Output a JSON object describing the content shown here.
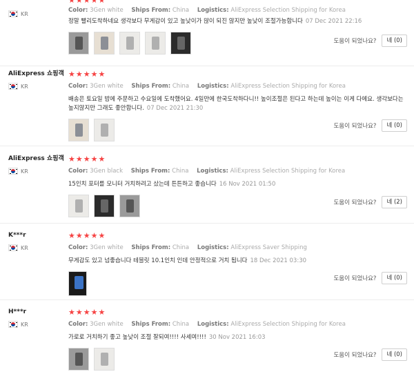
{
  "labels": {
    "color": "Color:",
    "ships_from": "Ships From:",
    "logistics": "Logistics:",
    "helpful": "도움이 되었나요?"
  },
  "reviews": [
    {
      "user": "",
      "country": "KR",
      "stars": 5,
      "color": "3Gen white",
      "ships_from": "China",
      "logistics": "AliExpress Selection Shipping for Korea",
      "text": "정말 빨리도착하네요 생각보다 무게감이 있고 높낮이가 많이 되진 않지만 높낮이 조절가능합니다",
      "date": "07 Dec 2021 22:16",
      "photos": [
        "grey-stand-photo",
        "tan-stand-photo",
        "stand-photo",
        "stand-photo",
        "dark-stand-photo"
      ],
      "helpful_button": "네 (0)"
    },
    {
      "user": "AliExpress 쇼핑객",
      "country": "KR",
      "stars": 5,
      "color": "3Gen white",
      "ships_from": "China",
      "logistics": "AliExpress Selection Shipping for Korea",
      "text": "배송은 토요일 밤에 주문하고 수요일에 도착했어요. 4일만에 한국도착하다니!! 높이조절은 된다고 하는데 높이는 이게 다에요. 생각보다는 높지않지만 그래도 좋안합니다.",
      "date": "07 Dec 2021 21:30",
      "photos": [
        "tan-stand-photo",
        "stand-photo"
      ],
      "helpful_button": "네 (0)"
    },
    {
      "user": "AliExpress 쇼핑객",
      "country": "KR",
      "stars": 5,
      "color": "3Gen black",
      "ships_from": "China",
      "logistics": "AliExpress Selection Shipping for Korea",
      "text": "15인치 포터를 모니터 거치하려고 샀는데 튼튼하고 좋습니다",
      "date": "16 Nov 2021 01:50",
      "photos": [
        "stand-photo",
        "dark-stand-photo",
        "grey-stand-photo"
      ],
      "helpful_button": "네 (2)"
    },
    {
      "user": "K***r",
      "country": "KR",
      "stars": 5,
      "color": "3Gen white",
      "ships_from": "China",
      "logistics": "AliExpress Saver Shipping",
      "text": "무게감도 있고 넘좋습니다 테블릿 10.1인치 인데 안정적으로 거치 됩니다",
      "date": "18 Dec 2021 03:30",
      "photos": [
        "tablet-on-stand-photo"
      ],
      "helpful_button": "네 (0)"
    },
    {
      "user": "H***r",
      "country": "KR",
      "stars": 5,
      "color": "3Gen white",
      "ships_from": "China",
      "logistics": "AliExpress Selection Shipping for Korea",
      "text": "가로로 거치하기 좋고 높낮이 조절 잘되여!!!! 사세여!!!!",
      "date": "30 Nov 2021 16:03",
      "photos": [
        "grey-stand-photo",
        "stand-photo"
      ],
      "helpful_button": "네 (0)"
    }
  ],
  "colors": {
    "star": "#f64343",
    "meta": "#aaaaaa",
    "separator": "#ececec"
  }
}
